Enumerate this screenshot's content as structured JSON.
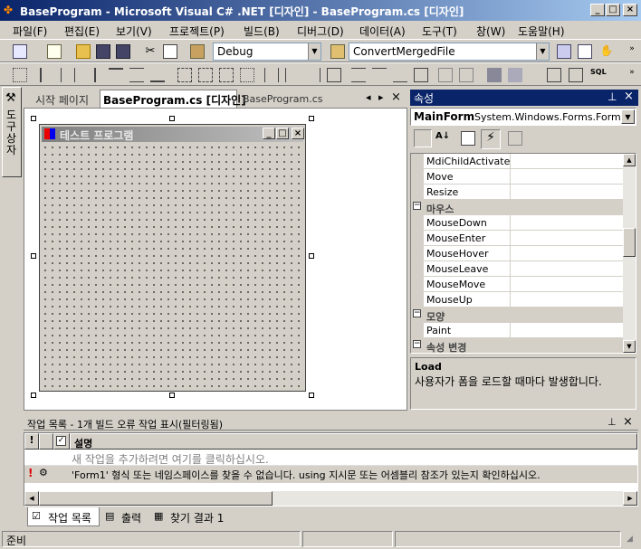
{
  "window": {
    "title": "BaseProgram - Microsoft Visual C# .NET [디자인] - BaseProgram.cs [디자인]",
    "caption_buttons": [
      "_",
      "□",
      "×"
    ]
  },
  "menu": [
    "파일(F)",
    "편집(E)",
    "보기(V)",
    "프로젝트(P)",
    "빌드(B)",
    "디버그(D)",
    "데이터(A)",
    "도구(T)",
    "창(W)",
    "도움말(H)"
  ],
  "toolbar": {
    "config": "Debug",
    "find": "ConvertMergedFile"
  },
  "left_toolbox": "도구 상자",
  "doc_tabs": [
    "시작 페이지",
    "BaseProgram.cs [디자인]",
    "BaseProgram.cs"
  ],
  "form": {
    "title": "테스트 프로그램",
    "caption_buttons": [
      "_",
      "□",
      "×"
    ]
  },
  "properties": {
    "header": "속성",
    "object_name": "MainForm",
    "object_type": "System.Windows.Forms.Form",
    "rows": [
      {
        "kind": "prop",
        "name": "MdiChildActivate"
      },
      {
        "kind": "prop",
        "name": "Move"
      },
      {
        "kind": "prop",
        "name": "Resize"
      },
      {
        "kind": "cat",
        "name": "마우스"
      },
      {
        "kind": "prop",
        "name": "MouseDown"
      },
      {
        "kind": "prop",
        "name": "MouseEnter"
      },
      {
        "kind": "prop",
        "name": "MouseHover"
      },
      {
        "kind": "prop",
        "name": "MouseLeave"
      },
      {
        "kind": "prop",
        "name": "MouseMove"
      },
      {
        "kind": "prop",
        "name": "MouseUp"
      },
      {
        "kind": "cat",
        "name": "모양"
      },
      {
        "kind": "prop",
        "name": "Paint"
      },
      {
        "kind": "cat",
        "name": "속성 변경"
      }
    ],
    "desc_title": "Load",
    "desc_text": "사용자가 폼을 로드할 때마다 발생합니다."
  },
  "tasks": {
    "header": "작업 목록 - 1개 빌드 오류 작업 표시(필터링됨)",
    "col_desc": "설명",
    "add_row": "새 작업을 추가하려면 여기를 클릭하십시오.",
    "error_row": "'Form1' 형식 또는 네임스페이스를 찾을 수 없습니다. using 지시문 또는 어셈블리 참조가 있는지 확인하십시오."
  },
  "bottom_tabs": [
    "작업 목록",
    "출력",
    "찾기 결과 1"
  ],
  "status": "준비"
}
